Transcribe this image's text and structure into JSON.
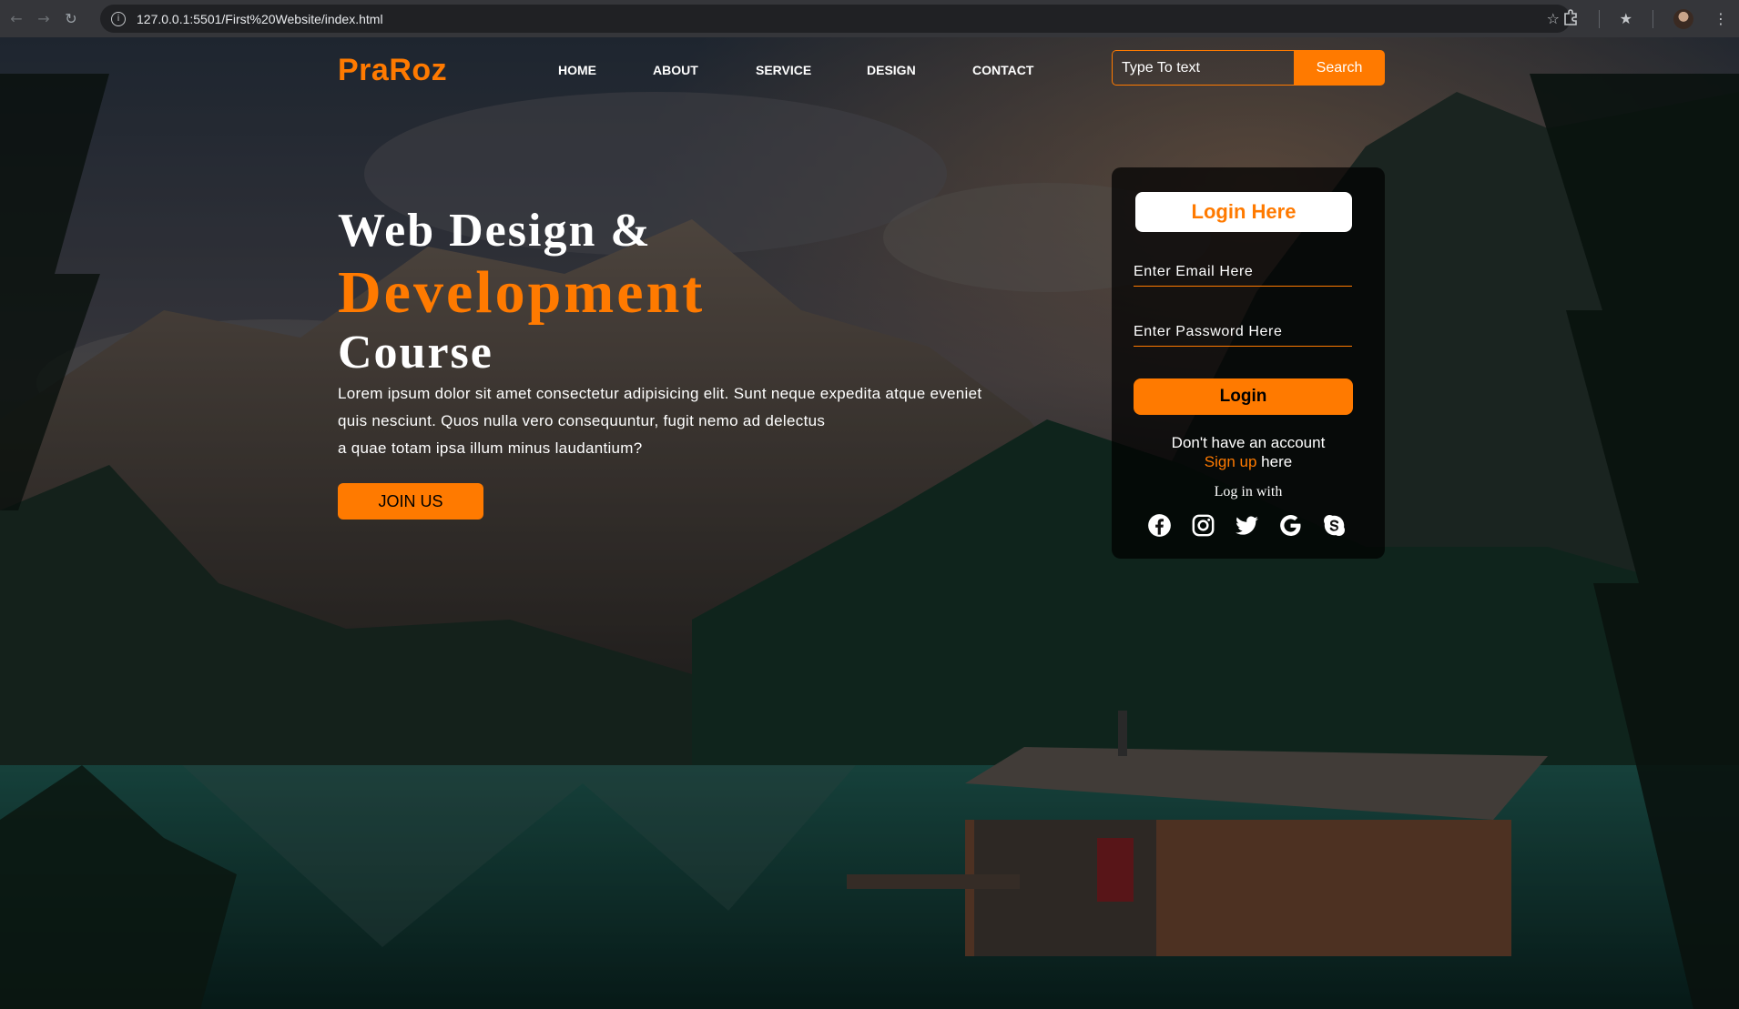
{
  "browser": {
    "url": "127.0.0.1:5501/First%20Website/index.html"
  },
  "header": {
    "logo": "PraRoz",
    "menu": [
      "HOME",
      "ABOUT",
      "SERVICE",
      "DESIGN",
      "CONTACT"
    ],
    "search": {
      "placeholder": "Type To text",
      "button_label": "Search"
    }
  },
  "hero": {
    "line1": "Web Design &",
    "line2": "Development",
    "line3": "Course",
    "paragraph": [
      "Lorem ipsum dolor sit amet consectetur adipisicing elit. Sunt neque expedita atque eveniet",
      "quis nesciunt. Quos nulla vero consequuntur, fugit nemo ad delectus",
      "a quae totam ipsa illum minus laudantium?"
    ],
    "cta_label": "JOIN US"
  },
  "login": {
    "title": "Login Here",
    "email_placeholder": "Enter Email Here",
    "password_placeholder": "Enter Password Here",
    "button_label": "Login",
    "no_account": "Don't have an account",
    "signup_link": "Sign up",
    "signup_suffix": " here",
    "login_with": "Log in with",
    "social_icons": [
      "facebook-icon",
      "instagram-icon",
      "twitter-icon",
      "google-icon",
      "skype-icon"
    ]
  },
  "colors": {
    "accent": "#ff7a00",
    "text": "#ffffff",
    "card_bg": "#000000"
  }
}
